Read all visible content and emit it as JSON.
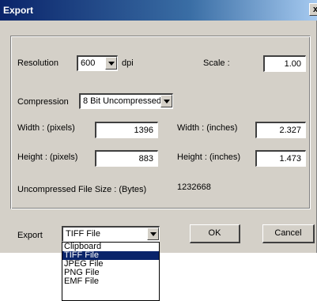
{
  "window": {
    "title": "Export",
    "close_glyph": "x"
  },
  "resolution": {
    "label": "Resolution",
    "value": "600",
    "unit": "dpi"
  },
  "scale": {
    "label": "Scale :",
    "value": "1.00"
  },
  "compression": {
    "label": "Compression",
    "value": "8 Bit Uncompressed"
  },
  "width_pixels": {
    "label": "Width : (pixels)",
    "value": "1396"
  },
  "height_pixels": {
    "label": "Height : (pixels)",
    "value": "883"
  },
  "width_inches": {
    "label": "Width : (inches)",
    "value": "2.327"
  },
  "height_inches": {
    "label": "Height : (inches)",
    "value": "1.473"
  },
  "file_size": {
    "label": "Uncompressed File Size : (Bytes)",
    "value": "1232668"
  },
  "export": {
    "label": "Export",
    "value": "TIFF File",
    "options": [
      "Clipboard",
      "TIFF File",
      "JPEG File",
      "PNG File",
      "EMF File"
    ],
    "selected_index": 1
  },
  "buttons": {
    "ok": "OK",
    "cancel": "Cancel"
  },
  "colors": {
    "title_bar": "#0a246a",
    "face": "#d4d0c8",
    "highlight": "#0a246a"
  },
  "icons": {
    "dropdown": "chevron-down-icon",
    "close": "close-icon"
  }
}
